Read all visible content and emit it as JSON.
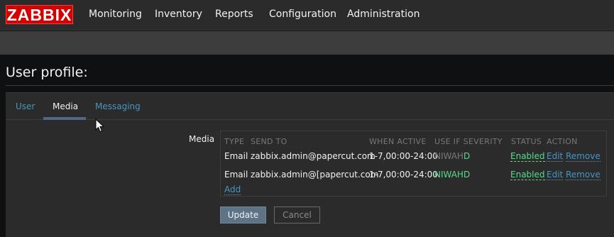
{
  "app": {
    "logo_text": "ZABBIX",
    "brand_color": "#d40000"
  },
  "topnav": {
    "items": [
      {
        "label": "Monitoring"
      },
      {
        "label": "Inventory"
      },
      {
        "label": "Reports"
      },
      {
        "label": "Configuration"
      },
      {
        "label": "Administration"
      }
    ]
  },
  "page": {
    "title": "User profile:"
  },
  "tabs": [
    {
      "label": "User",
      "active": false
    },
    {
      "label": "Media",
      "active": true
    },
    {
      "label": "Messaging",
      "active": false
    }
  ],
  "media": {
    "field_label": "Media",
    "columns": [
      "TYPE",
      "SEND TO",
      "WHEN ACTIVE",
      "USE IF SEVERITY",
      "STATUS",
      "ACTION"
    ],
    "rows": [
      {
        "type": "Email",
        "send_to": "zabbix.admin@papercut.com",
        "when_active": "1-7,00:00-24:00",
        "severity_dim": "NIWAH",
        "severity_on": "D",
        "status": "Enabled",
        "edit": "Edit",
        "remove": "Remove"
      },
      {
        "type": "Email",
        "send_to": "zabbix.admin@[papercut.com",
        "when_active": "1-7,00:00-24:00",
        "severity_dim": "",
        "severity_on": "NIWAHD",
        "status": "Enabled",
        "edit": "Edit",
        "remove": "Remove"
      }
    ],
    "add_label": "Add"
  },
  "buttons": {
    "update": "Update",
    "cancel": "Cancel"
  },
  "colors": {
    "link": "#4796c4",
    "enabled": "#59db8f",
    "header_bg": "#2b2b2b",
    "subnav_bg": "#3d3d3d",
    "page_bg": "#0e1012"
  },
  "icons": {
    "cursor": "mouse-pointer-icon"
  }
}
